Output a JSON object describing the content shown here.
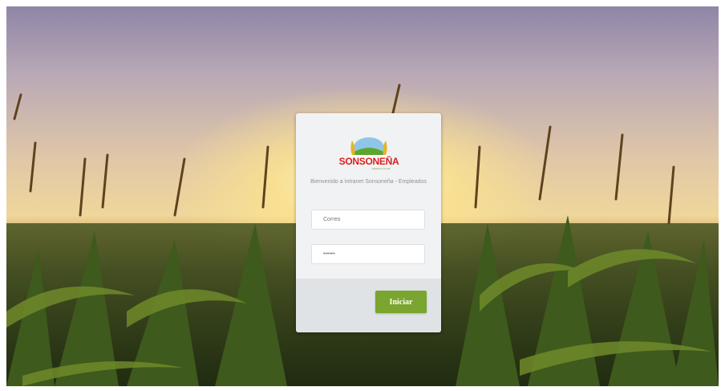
{
  "brand": {
    "name": "SONSONEÑA",
    "tagline": "Ganamos a tu casa"
  },
  "login": {
    "welcome": "Bienvenido a Intranet Sonsoneña - Empleados",
    "email_placeholder": "Correo",
    "password_value": "••••••",
    "submit_label": "Iniciar"
  },
  "colors": {
    "accent": "#7aa52e",
    "brand_red": "#d81e1e"
  }
}
